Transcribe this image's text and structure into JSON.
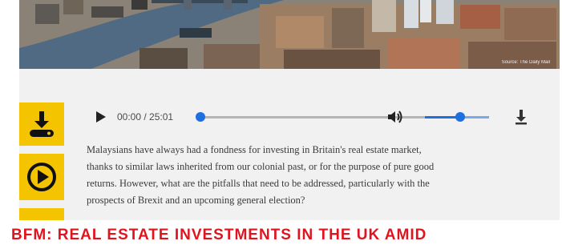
{
  "photo": {
    "caption": "Source: The Daily Mail"
  },
  "player": {
    "time_display": "00:00 / 25:01",
    "progress": 0,
    "volume": 0.55
  },
  "article": {
    "lines": [
      "Malaysians have always had a fondness for investing in Britain's real estate market,",
      "thanks to similar laws inherited from our colonial past, or for the purpose of pure good",
      "returns. However, what are the pitfalls that need to be addressed, particularly with the",
      "prospects of Brexit and an upcoming general election?"
    ]
  },
  "headline": {
    "text": "BFM: REAL ESTATE INVESTMENTS IN THE UK AMID"
  },
  "colors": {
    "accent_yellow": "#f5c400",
    "player_blue": "#1e6fe0",
    "headline_red": "#e0141e"
  },
  "icons": {
    "side_download": "download-icon",
    "side_play": "play-circle-icon",
    "player_play": "play-icon",
    "player_volume": "volume-icon",
    "player_download": "download-icon"
  }
}
